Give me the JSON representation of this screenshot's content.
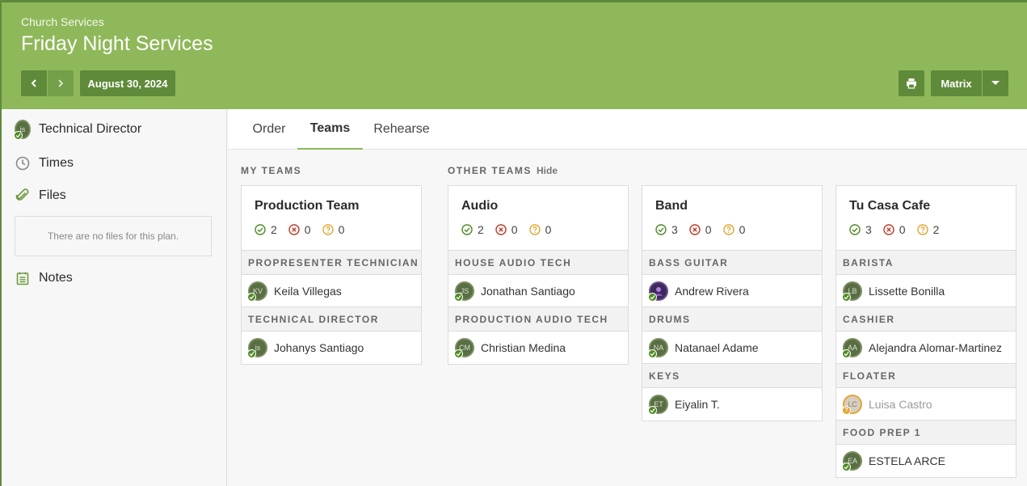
{
  "header": {
    "breadcrumb": "Church Services",
    "title": "Friday Night Services",
    "date_label": "August 30, 2024",
    "view_label": "Matrix"
  },
  "colors": {
    "header_bg": "#8fb85a",
    "button_bg": "#5f8a3a",
    "confirmed": "#4f8a24",
    "declined": "#c0392b",
    "pending": "#e3a534"
  },
  "sidebar": {
    "items": [
      {
        "label": "Technical Director",
        "icon": "avatar-js"
      },
      {
        "label": "Times",
        "icon": "clock-icon"
      },
      {
        "label": "Files",
        "icon": "paperclip-icon"
      },
      {
        "label": "Notes",
        "icon": "notes-icon"
      }
    ],
    "avatar_initials": "js",
    "files_empty": "There are no files for this plan."
  },
  "tabs": [
    "Order",
    "Teams",
    "Rehearse"
  ],
  "active_tab": "Teams",
  "sections": {
    "my_teams": "MY TEAMS",
    "other_teams": "OTHER TEAMS",
    "hide": "Hide"
  },
  "teams": [
    {
      "name": "Production Team",
      "confirmed": "2",
      "declined": "0",
      "pending": "0",
      "positions": [
        {
          "title": "PROPRESENTER TECHNICIAN",
          "people": [
            {
              "initials": "KV",
              "name": "Keila Villegas",
              "status": "confirmed"
            }
          ]
        },
        {
          "title": "TECHNICAL DIRECTOR",
          "people": [
            {
              "initials": "js",
              "name": "Johanys Santiago",
              "status": "confirmed"
            }
          ]
        }
      ]
    },
    {
      "name": "Audio",
      "confirmed": "2",
      "declined": "0",
      "pending": "0",
      "positions": [
        {
          "title": "HOUSE AUDIO TECH",
          "people": [
            {
              "initials": "JS",
              "name": "Jonathan Santiago",
              "status": "confirmed"
            }
          ]
        },
        {
          "title": "PRODUCTION AUDIO TECH",
          "people": [
            {
              "initials": "CM",
              "name": "Christian Medina",
              "status": "confirmed"
            }
          ]
        }
      ]
    },
    {
      "name": "Band",
      "confirmed": "3",
      "declined": "0",
      "pending": "0",
      "positions": [
        {
          "title": "BASS GUITAR",
          "people": [
            {
              "initials": "",
              "name": "Andrew Rivera",
              "status": "confirmed"
            }
          ]
        },
        {
          "title": "DRUMS",
          "people": [
            {
              "initials": "NA",
              "name": "Natanael Adame",
              "status": "confirmed"
            }
          ]
        },
        {
          "title": "KEYS",
          "people": [
            {
              "initials": "ET",
              "name": "Eiyalin T.",
              "status": "confirmed"
            }
          ]
        }
      ]
    },
    {
      "name": "Tu Casa Cafe",
      "confirmed": "3",
      "declined": "0",
      "pending": "2",
      "positions": [
        {
          "title": "BARISTA",
          "people": [
            {
              "initials": "LB",
              "name": "Lissette Bonilla",
              "status": "confirmed"
            }
          ]
        },
        {
          "title": "CASHIER",
          "people": [
            {
              "initials": "AA",
              "name": "Alejandra Alomar-Martinez",
              "status": "confirmed"
            }
          ]
        },
        {
          "title": "FLOATER",
          "people": [
            {
              "initials": "LC",
              "name": "Luisa Castro",
              "status": "pending"
            }
          ]
        },
        {
          "title": "FOOD PREP 1",
          "people": [
            {
              "initials": "EA",
              "name": "ESTELA ARCE",
              "status": "confirmed"
            }
          ]
        }
      ]
    }
  ]
}
